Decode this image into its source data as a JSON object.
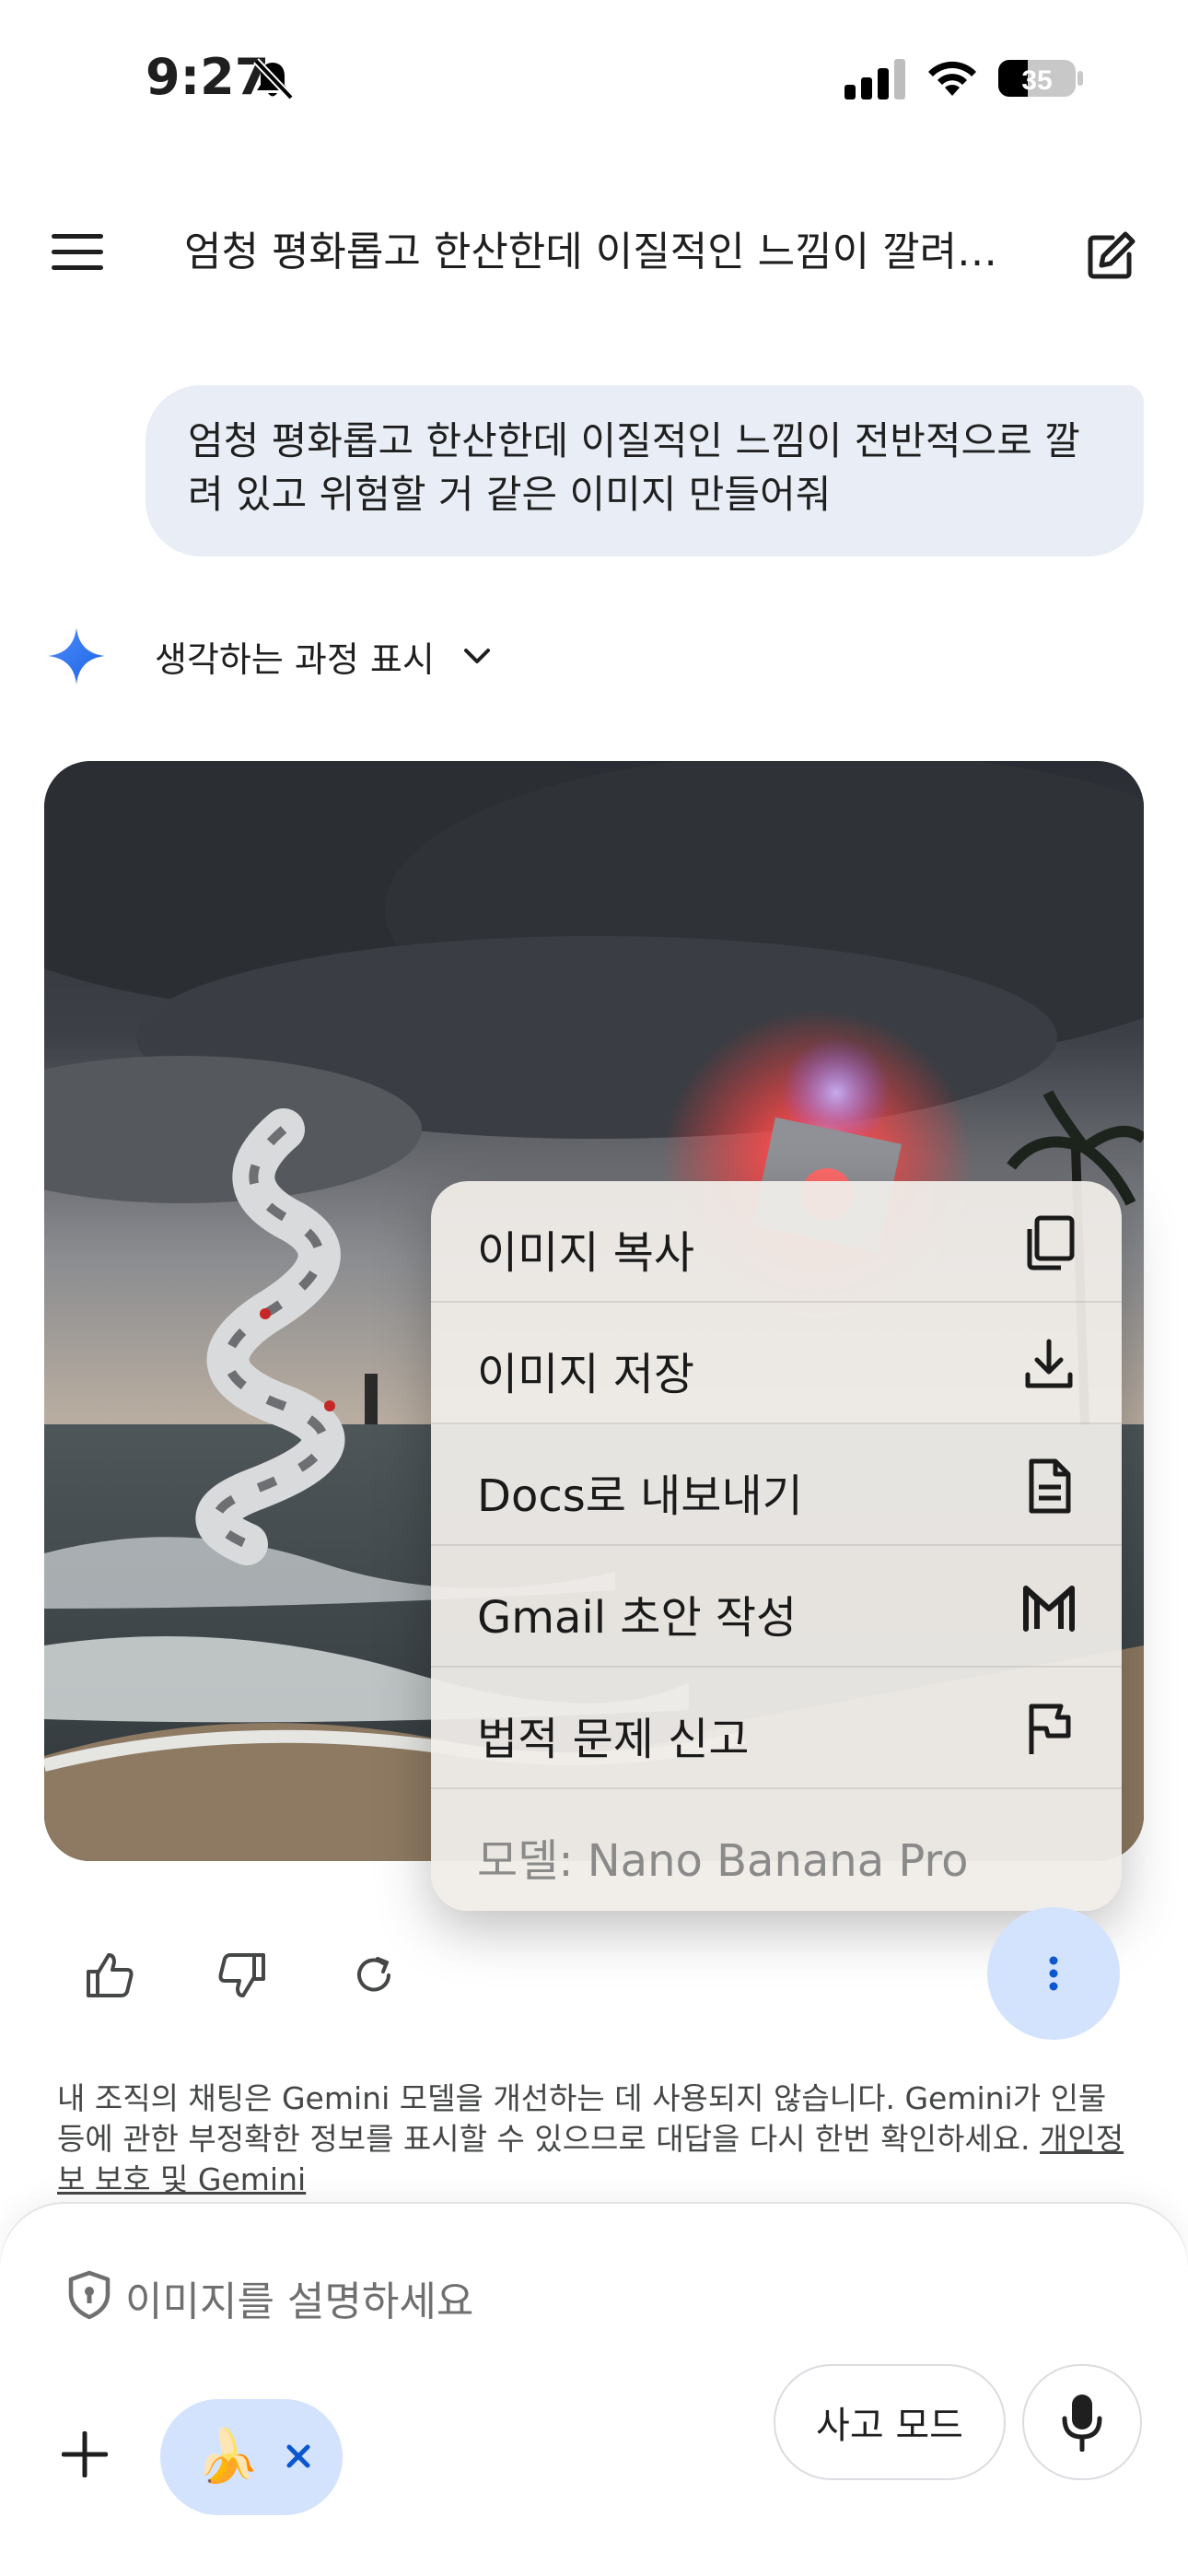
{
  "status_bar": {
    "time": "9:27",
    "battery": "35",
    "icons": [
      "bell-slash-icon",
      "signal-icon",
      "wifi-icon",
      "battery-icon"
    ]
  },
  "header": {
    "title": "엄청 평화롭고 한산한데 이질적인 느낌이 깔려…",
    "menu_icon": "hamburger-menu-icon",
    "edit_icon": "edit-icon"
  },
  "conversation": {
    "user_message": "엄청 평화롭고 한산한데 이질적인 느낌이 전반적으로 깔려 있고 위험할 거 같은 이미지 만들어줘",
    "thinking_label": "생각하는 과정 표시"
  },
  "context_menu": {
    "items": [
      {
        "label": "이미지 복사",
        "icon": "copy-icon"
      },
      {
        "label": "이미지 저장",
        "icon": "download-icon"
      },
      {
        "label": "Docs로 내보내기",
        "icon": "document-icon"
      },
      {
        "label": "Gmail 초안 작성",
        "icon": "gmail-icon"
      },
      {
        "label": "법적 문제 신고",
        "icon": "flag-icon"
      }
    ],
    "model_label": "모델: Nano Banana Pro"
  },
  "actions": {
    "icons": [
      "thumbs-up-icon",
      "thumbs-down-icon",
      "refresh-icon",
      "more-vert-icon"
    ]
  },
  "disclaimer": {
    "text": "내 조직의 채팅은 Gemini 모델을 개선하는 데 사용되지 않습니다. Gemini가 인물 등에 관한 부정확한 정보를 표시할 수 있으므로 대답을 다시 한번 확인하세요. ",
    "link": "개인정보 보호 및 Gemini"
  },
  "input": {
    "placeholder": "이미지를 설명하세요",
    "chip_emoji": "🍌",
    "think_mode_label": "사고 모드"
  },
  "colors": {
    "bubble": "#e9eef6",
    "accent_blue": "#0b57d0",
    "chip": "#d3e3fd"
  }
}
